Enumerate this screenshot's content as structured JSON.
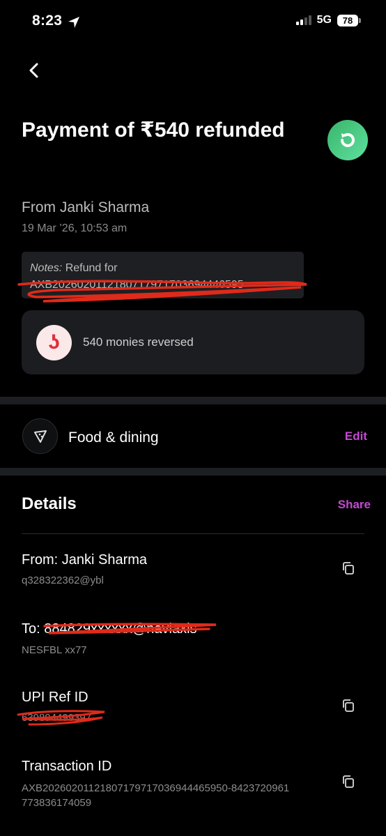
{
  "status_bar": {
    "time": "8:23",
    "network": "5G",
    "battery": "78"
  },
  "header": {
    "title": "Payment of ₹540 refunded",
    "from": "From Janki Sharma",
    "date": "19 Mar ’26, 10:53 am"
  },
  "notes": {
    "label": "Notes:",
    "text": "Refund for",
    "ref": "AXB2026020112180717971703694446595"
  },
  "monies": {
    "text": "540 monies reversed"
  },
  "category": {
    "label": "Food & dining",
    "edit_label": "Edit"
  },
  "details": {
    "heading": "Details",
    "share_label": "Share",
    "from_label": "From: Janki Sharma",
    "from_sub": "q328322362@ybl",
    "to_label": "To: 884829xxxxxx@naviaxis",
    "to_sub": "NESFBL xx77",
    "upi_label": "UPI Ref ID",
    "upi_sub": "639894499397",
    "txn_label": "Transaction ID",
    "txn_sub_line1": "AXB2026020112180717971703694446595​0-8423720961",
    "txn_sub_line2": "773836174059"
  },
  "colors": {
    "accent": "#c449d4",
    "refund_green": "#39b56a",
    "brand_red": "#e0303a"
  }
}
